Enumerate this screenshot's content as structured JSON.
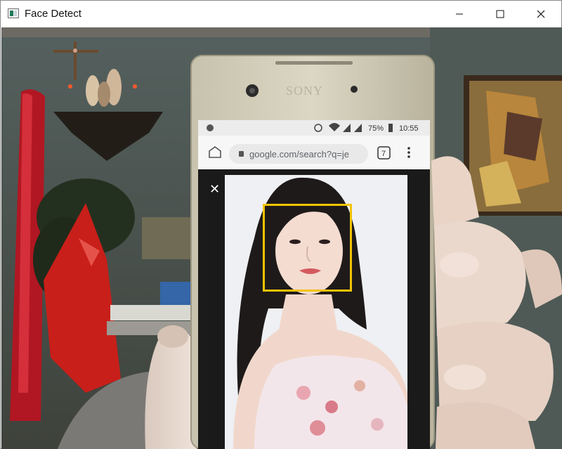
{
  "window": {
    "title": "Face Detect",
    "icons": {
      "app": "app-window-icon",
      "minimize": "minimize-icon",
      "maximize": "maximize-icon",
      "close": "close-icon"
    }
  },
  "camera_feed": {
    "detection_box_color": "#f2c400",
    "phone": {
      "brand": "SONY",
      "status_bar": {
        "battery": "75%",
        "time": "10:55"
      },
      "browser": {
        "url": "google.com/search?q=je",
        "tab_count": "7"
      },
      "image_viewer": {
        "close_glyph": "✕"
      }
    }
  }
}
